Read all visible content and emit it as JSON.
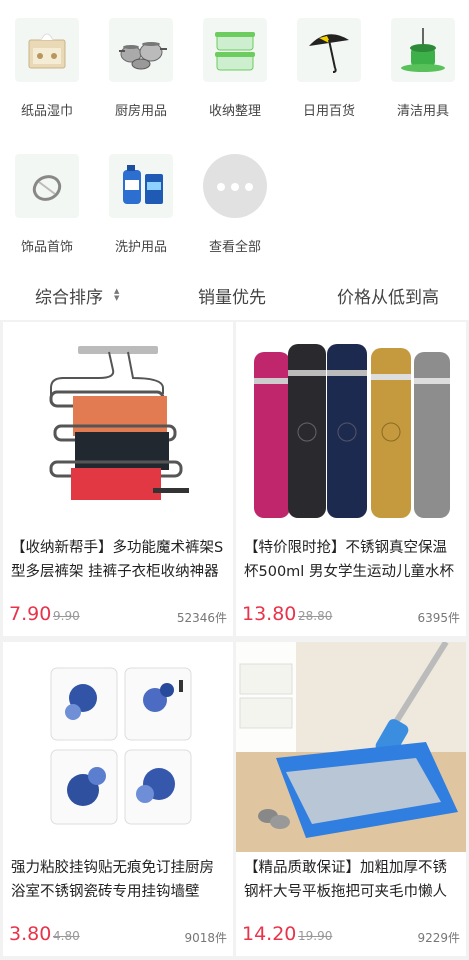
{
  "categories": [
    {
      "label": "纸品湿巾",
      "icon": "tissue-box-icon"
    },
    {
      "label": "厨房用品",
      "icon": "cookware-icon"
    },
    {
      "label": "收纳整理",
      "icon": "storage-box-icon"
    },
    {
      "label": "日用百货",
      "icon": "umbrella-icon"
    },
    {
      "label": "清洁用具",
      "icon": "mop-bucket-icon"
    },
    {
      "label": "饰品首饰",
      "icon": "ring-icon"
    },
    {
      "label": "洗护用品",
      "icon": "detergent-icon"
    },
    {
      "label": "查看全部",
      "icon": "more-icon"
    }
  ],
  "sort": {
    "default_label": "综合排序",
    "sales_label": "销量优先",
    "price_label": "价格从低到高",
    "arrow": "▲▼"
  },
  "products": [
    {
      "title": "【收纳新帮手】多功能魔术裤架S型多层裤架 挂裤子衣柜收纳神器",
      "price": "7.90",
      "old_price": "9.90",
      "sold": "52346件",
      "image": "pants-hanger"
    },
    {
      "title": "【特价限时抢】不锈钢真空保温杯500ml 男女学生运动儿童水杯",
      "price": "13.80",
      "old_price": "28.80",
      "sold": "6395件",
      "image": "thermos-bottles"
    },
    {
      "title": "强力粘胶挂钩贴无痕免订挂厨房浴室不锈钢瓷砖专用挂钩墙壁",
      "price": "3.80",
      "old_price": "4.80",
      "sold": "9018件",
      "image": "adhesive-hooks"
    },
    {
      "title": "【精品质敢保证】加粗加厚不锈钢杆大号平板拖把可夹毛巾懒人",
      "price": "14.20",
      "old_price": "19.90",
      "sold": "9229件",
      "image": "flat-mop"
    }
  ],
  "colors": {
    "price": "#e8344b",
    "background": "#f2f2f2"
  }
}
